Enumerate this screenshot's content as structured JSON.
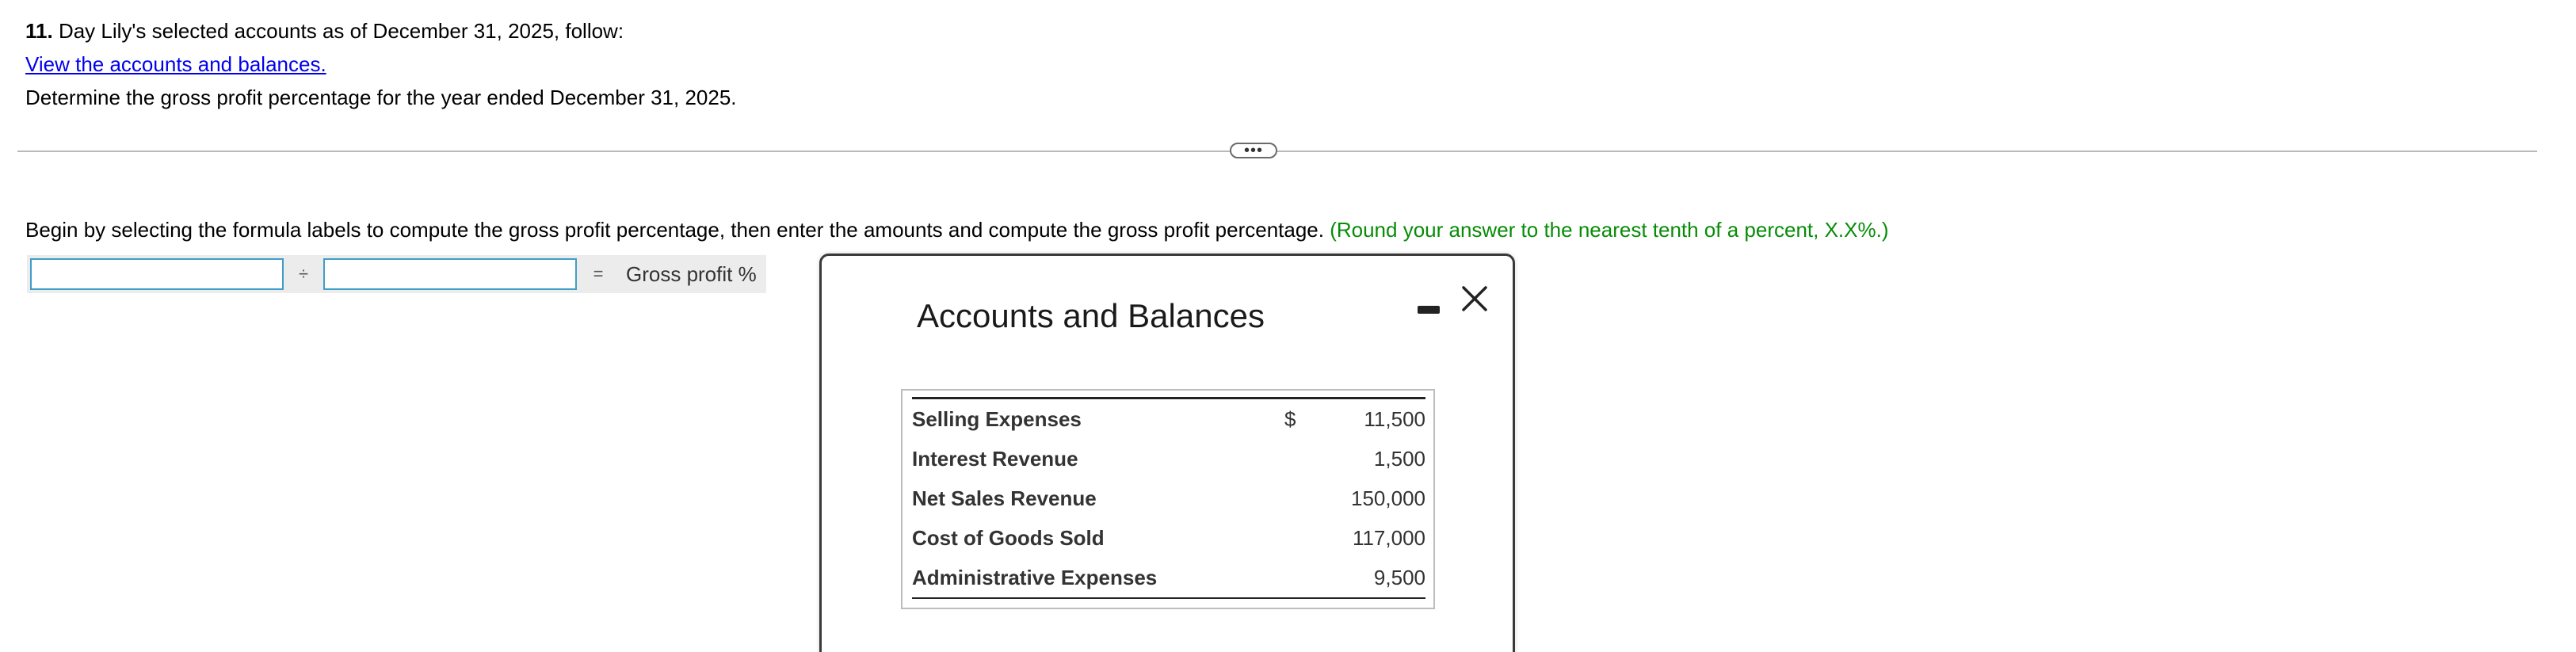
{
  "question": {
    "number": "11.",
    "intro": " Day Lily's selected accounts as of December 31, 2025, follow:",
    "link_text": "View the accounts and balances.",
    "task": "Determine the gross profit percentage for the year ended December 31, 2025."
  },
  "expand_handle": {
    "label": "•••"
  },
  "instructions": {
    "text": "Begin by selecting the formula labels to compute the gross profit percentage, then enter the amounts and compute the gross profit percentage. ",
    "hint": "(Round your answer to the nearest tenth of a percent, X.X%.)"
  },
  "formula": {
    "input1_value": "",
    "divide_symbol": "÷",
    "input2_value": "",
    "equals_symbol": "=",
    "result_label": "Gross profit %"
  },
  "modal": {
    "title": "Accounts and Balances",
    "currency_symbol": "$",
    "accounts": [
      {
        "name": "Selling Expenses",
        "currency": "$",
        "amount": "11,500"
      },
      {
        "name": "Interest Revenue",
        "currency": "",
        "amount": "1,500"
      },
      {
        "name": "Net Sales Revenue",
        "currency": "",
        "amount": "150,000"
      },
      {
        "name": "Cost of Goods Sold",
        "currency": "",
        "amount": "117,000"
      },
      {
        "name": "Administrative Expenses",
        "currency": "",
        "amount": "9,500"
      }
    ]
  },
  "colors": {
    "link": "#0000ee",
    "hint": "#078c07",
    "input_border": "#3e9ec8"
  }
}
